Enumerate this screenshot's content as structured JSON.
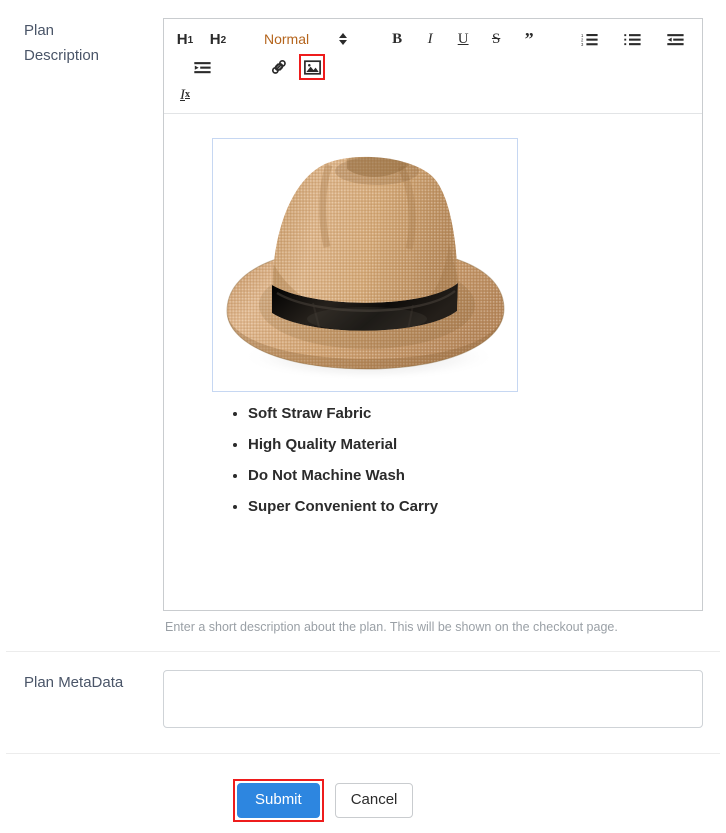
{
  "fields": {
    "description": {
      "label_line1": "Plan",
      "label_line2": "Description",
      "help_text": "Enter a short description about the plan. This will be shown on the checkout page."
    },
    "metadata": {
      "label": "Plan MetaData",
      "value": "",
      "placeholder": ""
    }
  },
  "editor": {
    "toolbar": {
      "h1_label": "H",
      "h1_level": "1",
      "h2_label": "H",
      "h2_level": "2",
      "style_select": "Normal",
      "bold_label": "B",
      "italic_label": "I",
      "underline_label": "U",
      "strike_label": "S",
      "quote_label": "”",
      "clear_label": "I",
      "clear_sub": "x",
      "icons": {
        "ordered_list": "ordered-list-icon",
        "bullet_list": "bullet-list-icon",
        "outdent": "outdent-icon",
        "indent": "indent-icon",
        "link": "link-icon",
        "image": "image-icon",
        "style_chevron": "chevron-updown-icon"
      },
      "highlighted_tool": "image-icon"
    },
    "content": {
      "image_alt": "straw-fedora-hat",
      "bullets": [
        "Soft Straw Fabric",
        "High Quality Material",
        "Do Not Machine Wash",
        "Super Convenient to Carry"
      ]
    }
  },
  "footer": {
    "submit_label": "Submit",
    "cancel_label": "Cancel",
    "highlighted_button": "submit-button"
  },
  "colors": {
    "accent_blue": "#2d86e0",
    "highlight_red": "#ee1c1c",
    "label_text": "#4a5568",
    "help_text": "#9aa0a6",
    "editor_border": "#c9cccf",
    "image_frame_border": "#c6d7f2",
    "style_select_text": "#b5651d",
    "hat_straw": "#d8ab77",
    "hat_band": "#15120f"
  }
}
